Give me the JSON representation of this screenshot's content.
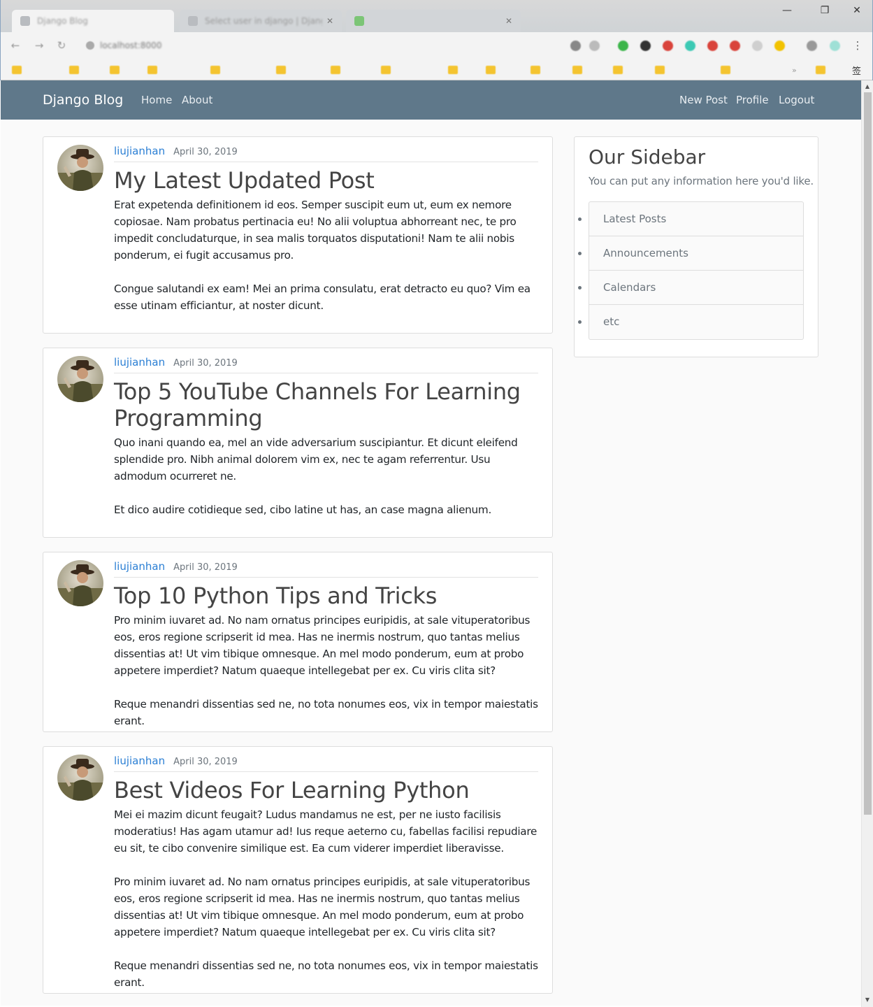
{
  "browser": {
    "tabs": [
      {
        "title": "Django Blog",
        "active": true
      },
      {
        "title": "Select user in django | Django",
        "active": false
      },
      {
        "title": "",
        "active": false
      }
    ],
    "window_controls": {
      "minimize": "—",
      "maximize": "❐",
      "close": "✕"
    },
    "address": "localhost:8000",
    "bookmarks": [
      "",
      "",
      "",
      "",
      "",
      "",
      "",
      "",
      "",
      "",
      "",
      "",
      "",
      "",
      "",
      "",
      ""
    ],
    "bookmarks_overflow": "签",
    "icons": {
      "back": "back-arrow-icon",
      "forward": "forward-arrow-icon",
      "reload": "reload-icon",
      "menu": "kebab-menu-icon"
    }
  },
  "navbar": {
    "brand": "Django Blog",
    "left_links": [
      "Home",
      "About"
    ],
    "right_links": [
      "New Post",
      "Profile",
      "Logout"
    ],
    "color": "#5f788a"
  },
  "posts": [
    {
      "author": "liujianhan",
      "date": "April 30, 2019",
      "title": "My Latest Updated Post",
      "content": "Erat expetenda definitionem id eos. Semper suscipit eum ut, eum ex nemore copiosae. Nam probatus pertinacia eu! No alii voluptua abhorreant nec, te pro impedit concludaturque, in sea malis torquatos disputationi! Nam te alii nobis ponderum, ei fugit accusamus pro.\n\nCongue salutandi ex eam! Mei an prima consulatu, erat detracto eu quo? Vim ea esse utinam efficiantur, at noster dicunt."
    },
    {
      "author": "liujianhan",
      "date": "April 30, 2019",
      "title": "Top 5 YouTube Channels For Learning Programming",
      "content": "Quo inani quando ea, mel an vide adversarium suscipiantur. Et dicunt eleifend splendide pro. Nibh animal dolorem vim ex, nec te agam referrentur. Usu admodum ocurreret ne.\n\nEt dico audire cotidieque sed, cibo latine ut has, an case magna alienum."
    },
    {
      "author": "liujianhan",
      "date": "April 30, 2019",
      "title": "Top 10 Python Tips and Tricks",
      "content": "Pro minim iuvaret ad. No nam ornatus principes euripidis, at sale vituperatoribus eos, eros regione scripserit id mea. Has ne inermis nostrum, quo tantas melius dissentias at! Ut vim tibique omnesque. An mel modo ponderum, eum at probo appetere imperdiet? Natum quaeque intellegebat per ex. Cu viris clita sit?\n\nReque menandri dissentias sed ne, no tota nonumes eos, vix in tempor maiestatis erant."
    },
    {
      "author": "liujianhan",
      "date": "April 30, 2019",
      "title": "Best Videos For Learning Python",
      "content": "Mei ei mazim dicunt feugait? Ludus mandamus ne est, per ne iusto facilisis moderatius! Has agam utamur ad! Ius reque aeterno cu, fabellas facilisi repudiare eu sit, te cibo convenire similique est. Ea cum viderer imperdiet liberavisse.\n\nPro minim iuvaret ad. No nam ornatus principes euripidis, at sale vituperatoribus eos, eros regione scripserit id mea. Has ne inermis nostrum, quo tantas melius dissentias at! Ut vim tibique omnesque. An mel modo ponderum, eum at probo appetere imperdiet? Natum quaeque intellegebat per ex. Cu viris clita sit?\n\nReque menandri dissentias sed ne, no tota nonumes eos, vix in tempor maiestatis erant."
    }
  ],
  "sidebar": {
    "title": "Our Sidebar",
    "subtitle": "You can put any information here you'd like.",
    "items": [
      "Latest Posts",
      "Announcements",
      "Calendars",
      "etc"
    ]
  },
  "scrollbar": {
    "up": "▲",
    "down": "▼"
  },
  "colors": {
    "link": "#2b7fd4",
    "muted": "#6c757d",
    "title": "#444444"
  }
}
